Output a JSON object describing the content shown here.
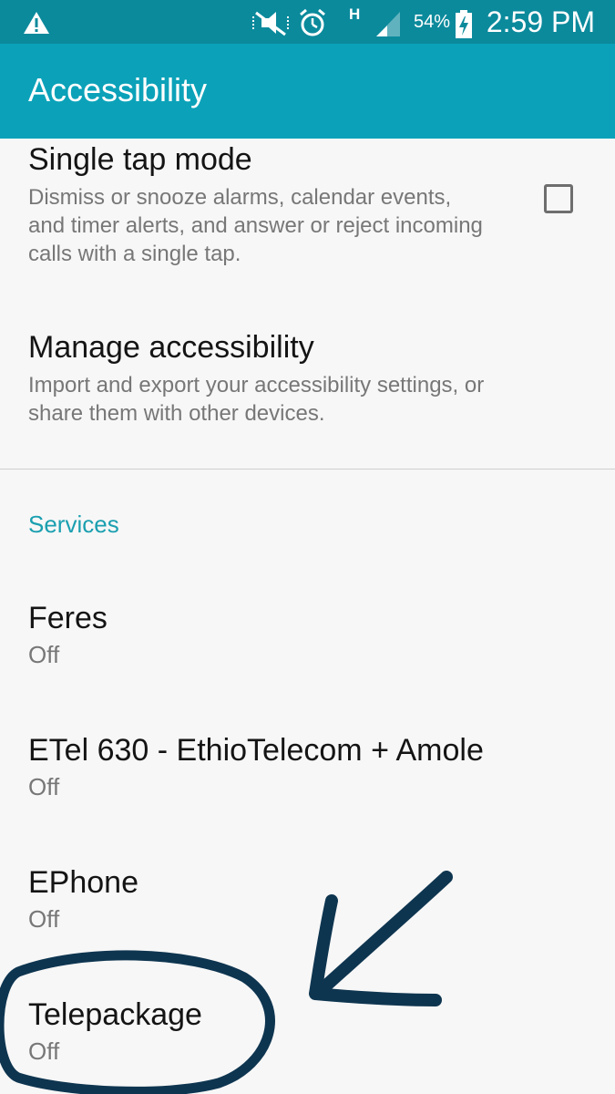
{
  "status_bar": {
    "battery_percent": "54%",
    "time": "2:59 PM",
    "network_type": "H",
    "icons": [
      "warning-icon",
      "mute-icon",
      "alarm-icon",
      "signal-icon",
      "battery-charging-icon"
    ]
  },
  "app_bar": {
    "title": "Accessibility",
    "color": "#0ba2b9"
  },
  "settings": [
    {
      "title": "Single tap mode",
      "description_lines": [
        "Dismiss or snooze alarms, calendar events,",
        "and timer alerts, and answer or reject incoming",
        "calls with a single tap."
      ],
      "checked": false
    },
    {
      "title": "Manage accessibility",
      "description_lines": [
        "Import and export your accessibility settings, or",
        "share them with other devices."
      ]
    }
  ],
  "services": {
    "header": "Services",
    "items": [
      {
        "name": "Feres",
        "status": "Off"
      },
      {
        "name": "ETel 630 - EthioTelecom + Amole",
        "status": "Off"
      },
      {
        "name": "EPhone",
        "status": "Off"
      },
      {
        "name": "Telepackage",
        "status": "Off"
      }
    ]
  },
  "annotation": {
    "color": "#0e3550",
    "shapes": [
      "hand-drawn-circle",
      "hand-drawn-arrow"
    ]
  }
}
